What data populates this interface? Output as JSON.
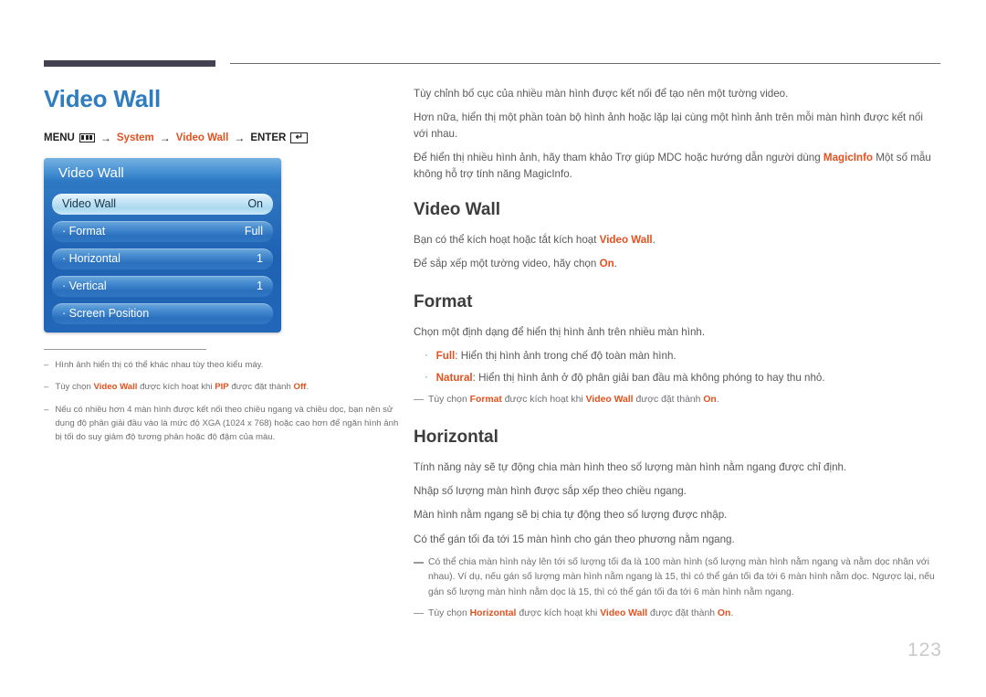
{
  "header": {
    "page_title": "Video Wall",
    "title_color": "#2f7dc0"
  },
  "menu_path": {
    "menu_label": "MENU",
    "menu_icon": "menu-bars-icon",
    "arrow": "→",
    "step1": "System",
    "step2": "Video Wall",
    "enter_label": "ENTER",
    "enter_icon": "enter-key-icon",
    "enter_glyph": "↵",
    "accent_color": "#e2521f"
  },
  "osd": {
    "title": "Video Wall",
    "rows": [
      {
        "label": "Video Wall",
        "value": "On",
        "selected": true
      },
      {
        "label": "· Format",
        "value": "Full",
        "selected": false
      },
      {
        "label": "· Horizontal",
        "value": "1",
        "selected": false
      },
      {
        "label": "· Vertical",
        "value": "1",
        "selected": false
      },
      {
        "label": "· Screen Position",
        "value": "",
        "selected": false
      }
    ]
  },
  "left_notes": [
    {
      "dash": "–",
      "parts": [
        {
          "t": "Hình ảnh hiển thị có thể khác nhau tùy theo kiểu máy.",
          "b": false
        }
      ]
    },
    {
      "dash": "–",
      "parts": [
        {
          "t": "Tùy chọn ",
          "b": false
        },
        {
          "t": "Video Wall",
          "b": true
        },
        {
          "t": " được kích hoạt khi ",
          "b": false
        },
        {
          "t": "PIP",
          "b": true
        },
        {
          "t": " được đặt thành ",
          "b": false
        },
        {
          "t": "Off",
          "b": true
        },
        {
          "t": ".",
          "b": false
        }
      ]
    },
    {
      "dash": "–",
      "parts": [
        {
          "t": "Nếu có nhiều hơn 4 màn hình được kết nối theo chiều ngang và chiều dọc, bạn nên sử dụng độ phân giải đầu vào là mức độ XGA (1024 x 768) hoặc cao hơn để ngăn hình ảnh bị tối do suy giảm độ tương phản hoặc độ đậm của màu.",
          "b": false
        }
      ]
    }
  ],
  "intro": [
    {
      "parts": [
        {
          "t": "Tùy chỉnh bố cục của nhiều màn hình được kết nối để tạo nên một tường video.",
          "b": false
        }
      ]
    },
    {
      "parts": [
        {
          "t": "Hơn nữa, hiển thị một phần toàn bộ hình ảnh hoặc lặp lại cùng một hình ảnh trên mỗi màn hình được kết nối với nhau.",
          "b": false
        }
      ]
    },
    {
      "parts": [
        {
          "t": "Để hiển thị nhiều hình ảnh, hãy tham khảo Trợ giúp MDC hoặc hướng dẫn người dùng ",
          "b": false
        },
        {
          "t": "MagicInfo",
          "b": true
        },
        {
          "t": " Một số mẫu không hỗ trợ tính năng MagicInfo.",
          "b": false
        }
      ]
    }
  ],
  "sections": [
    {
      "heading": "Video Wall",
      "paragraphs": [
        {
          "parts": [
            {
              "t": "Bạn có thể kích hoạt hoặc tắt kích hoạt ",
              "b": false
            },
            {
              "t": "Video Wall",
              "b": true
            },
            {
              "t": ".",
              "b": false
            }
          ]
        },
        {
          "parts": [
            {
              "t": "Để sắp xếp một tường video, hãy chọn ",
              "b": false
            },
            {
              "t": "On",
              "b": true
            },
            {
              "t": ".",
              "b": false
            }
          ]
        }
      ],
      "bullets": [],
      "notes": []
    },
    {
      "heading": "Format",
      "paragraphs": [
        {
          "parts": [
            {
              "t": "Chọn một định dạng để hiển thị hình ảnh trên nhiều màn hình.",
              "b": false
            }
          ]
        }
      ],
      "bullets": [
        {
          "dot": "·",
          "parts": [
            {
              "t": "Full",
              "b": true
            },
            {
              "t": ": Hiển thị hình ảnh trong chế độ toàn màn hình.",
              "b": false
            }
          ]
        },
        {
          "dot": "·",
          "parts": [
            {
              "t": "Natural",
              "b": true
            },
            {
              "t": ": Hiển thị hình ảnh ở độ phân giải ban đầu mà không phóng to hay thu nhỏ.",
              "b": false
            }
          ]
        }
      ],
      "notes": [
        {
          "parts": [
            {
              "t": "Tùy chọn ",
              "b": false
            },
            {
              "t": "Format",
              "b": true
            },
            {
              "t": " được kích hoạt khi ",
              "b": false
            },
            {
              "t": "Video Wall",
              "b": true
            },
            {
              "t": " được đặt thành ",
              "b": false
            },
            {
              "t": "On",
              "b": true
            },
            {
              "t": ".",
              "b": false
            }
          ]
        }
      ]
    },
    {
      "heading": "Horizontal",
      "paragraphs": [
        {
          "parts": [
            {
              "t": "Tính năng này sẽ tự động chia màn hình theo số lượng màn hình nằm ngang được chỉ định.",
              "b": false
            }
          ]
        },
        {
          "parts": [
            {
              "t": "Nhập số lượng màn hình được sắp xếp theo chiều ngang.",
              "b": false
            }
          ]
        },
        {
          "parts": [
            {
              "t": "Màn hình nằm ngang sẽ bị chia tự động theo số lượng được nhập.",
              "b": false
            }
          ]
        },
        {
          "parts": [
            {
              "t": "Có thể gán tối đa tới 15 màn hình cho gán theo phương nằm ngang.",
              "b": false
            }
          ]
        }
      ],
      "bullets": [],
      "notes": [
        {
          "parts": [
            {
              "t": "Có thể chia màn hình này lên tới số lượng tối đa là 100 màn hình (số lượng màn hình nằm ngang và nằm dọc nhân với nhau). Ví dụ, nếu gán số lượng màn hình nằm ngang là 15, thì có thể gán tối đa tới 6 màn hình nằm dọc. Ngược lại, nếu gán số lượng màn hình nằm dọc là 15, thì có thể gán tối đa tới 6 màn hình nằm ngang.",
              "b": false
            }
          ]
        },
        {
          "parts": [
            {
              "t": "Tùy chọn ",
              "b": false
            },
            {
              "t": "Horizontal",
              "b": true
            },
            {
              "t": " được kích hoạt khi ",
              "b": false
            },
            {
              "t": "Video Wall",
              "b": true
            },
            {
              "t": " được đặt thành ",
              "b": false
            },
            {
              "t": "On",
              "b": true
            },
            {
              "t": ".",
              "b": false
            }
          ]
        }
      ]
    }
  ],
  "footer": {
    "page_number": "123"
  }
}
